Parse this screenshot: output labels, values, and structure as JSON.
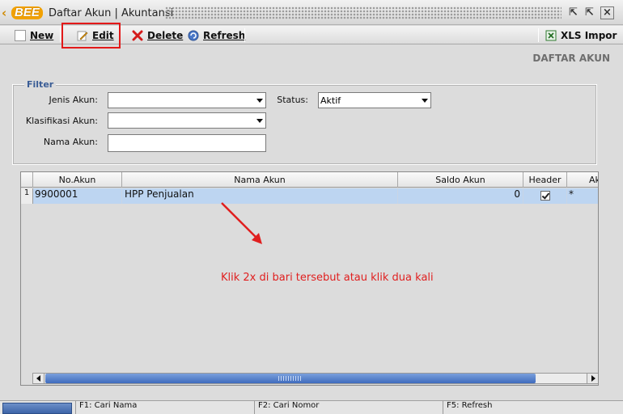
{
  "window": {
    "logo_text": "BEE",
    "title": "Daftar Akun | Akuntansi"
  },
  "toolbar": {
    "new_label": "New",
    "edit_label": "Edit",
    "delete_label": "Delete",
    "refresh_label": "Refresh",
    "xls_label": "XLS Impor"
  },
  "page_heading": "DAFTAR AKUN",
  "filter": {
    "legend": "Filter",
    "jenis_label": "Jenis Akun:",
    "jenis_value": "",
    "klasifikasi_label": "Klasifikasi Akun:",
    "klasifikasi_value": "",
    "nama_label": "Nama Akun:",
    "nama_value": "",
    "status_label": "Status:",
    "status_value": "Aktif"
  },
  "grid": {
    "columns": [
      "No.Akun",
      "Nama Akun",
      "Saldo Akun",
      "Header",
      "Ak"
    ],
    "rows": [
      {
        "row_no": "1",
        "no_akun": "9900001",
        "nama_akun": "HPP Penjualan",
        "saldo": "0",
        "header_checked": true,
        "ak": "*"
      }
    ]
  },
  "annotation": {
    "hint": "Klik 2x di bari tersebut atau klik dua kali",
    "color": "#e01f1f"
  },
  "statusbar": {
    "f1": "F1: Cari Nama",
    "f2": "F2: Cari Nomor",
    "f5": "F5: Refresh"
  },
  "colors": {
    "selected_row": "#bdd5f1",
    "highlight_box": "#e31919",
    "scroll_thumb": "#3f6bbd"
  }
}
